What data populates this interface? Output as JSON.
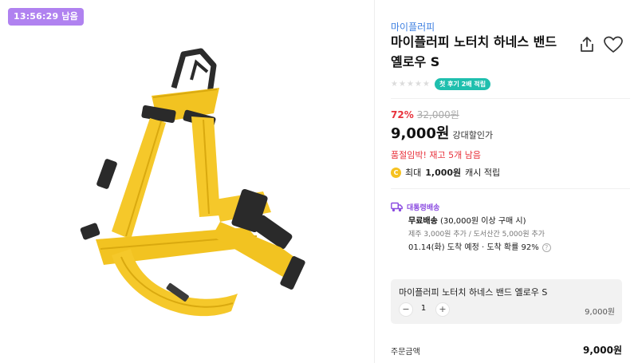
{
  "timer": {
    "text": "13:56:29 남음"
  },
  "product": {
    "brand": "마이플러피",
    "title": "마이플러피 노터치 하네스 밴드 옐로우 S",
    "image": "yellow-dog-harness",
    "review_badge": "첫 후기 2배 적립",
    "rating_stars": 0
  },
  "price": {
    "discount": "72%",
    "original": "32,000원",
    "sale": "9,000원",
    "tag": "강대할인가",
    "stock_warning": "품절임박! 재고 5개 남음"
  },
  "cash": {
    "prefix": "최대",
    "amount": "1,000원",
    "suffix": "캐시 적립"
  },
  "delivery": {
    "label": "대통령배송",
    "free_bold": "무료배송",
    "free_rest": "(30,000원 이상 구매 시)",
    "extra": "제주 3,000원 추가 / 도서산간 5,000원 추가",
    "eta": "01.14(화) 도착 예정 · 도착 확률 92%"
  },
  "option": {
    "name": "마이플러피 노터치 하네스 밴드 옐로우 S",
    "minus": "−",
    "quantity": "1",
    "plus": "+",
    "price": "9,000원"
  },
  "order": {
    "label": "주문금액",
    "total": "9,000원"
  },
  "colors": {
    "timer_bg": "#b082f0",
    "brand": "#3d7fe0",
    "discount": "#e8323c",
    "review_badge": "#1fbfae",
    "delivery": "#8a4be0",
    "coin": "#f6c220"
  },
  "icons": {
    "share": "share-icon",
    "wish": "heart-icon",
    "coin": "coin-icon",
    "truck": "truck-icon",
    "help": "help-icon"
  }
}
